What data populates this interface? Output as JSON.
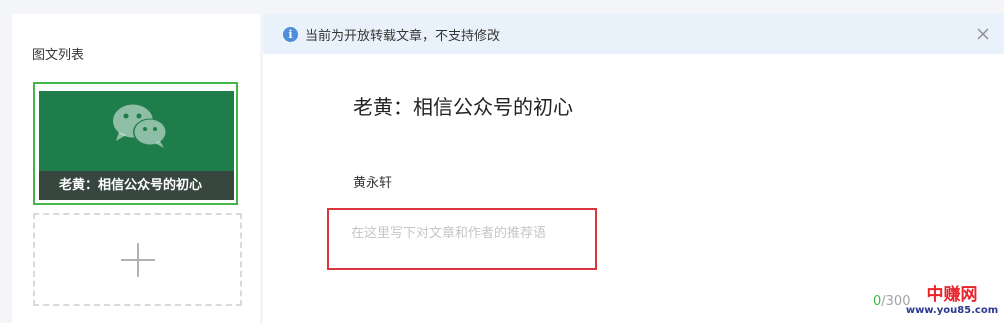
{
  "article_list": {
    "title": "图文列表",
    "items": [
      {
        "caption": "老黄：相信公众号的初心",
        "cover_icon": "wechat-icon"
      }
    ],
    "add_icon": "plus-icon"
  },
  "notice": {
    "icon": "info-icon",
    "text": "当前为开放转载文章，不支持修改",
    "close_icon": "close-icon"
  },
  "editor": {
    "title": "老黄：相信公众号的初心",
    "author": "黄永轩",
    "recommendation": {
      "value": "",
      "placeholder": "在这里写下对文章和作者的推荐语"
    },
    "counter": {
      "current": "0",
      "separator_max": "/300"
    }
  },
  "watermark": {
    "main": "中赚网",
    "url": "www.you85.com"
  },
  "colors": {
    "accent_green": "#44b549",
    "cover_green": "#1f7d4c",
    "notice_bg": "#e9f1fb",
    "info_blue": "#4c8ed9",
    "highlight_red": "#d9363e"
  }
}
